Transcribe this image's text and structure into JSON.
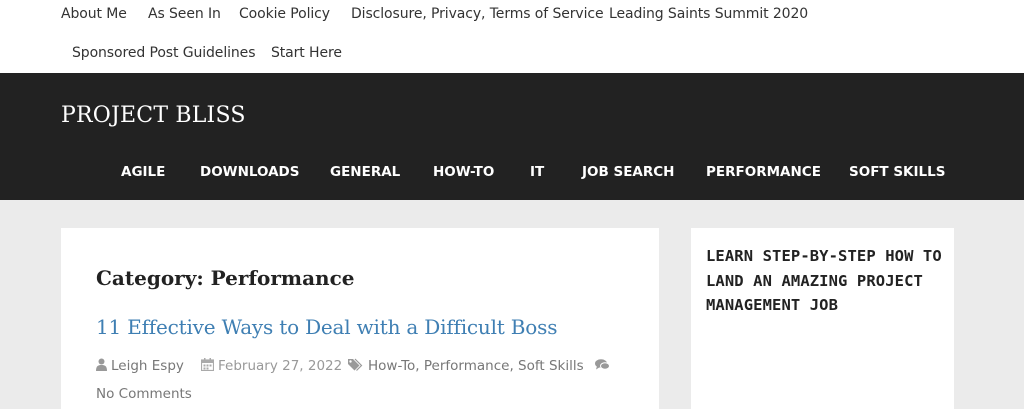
{
  "top_nav": {
    "items": [
      "About Me",
      "As Seen In",
      "Cookie Policy",
      "Disclosure, Privacy, Terms of Service",
      "Leading Saints Summit 2020",
      "Sponsored Post Guidelines",
      "Start Here"
    ]
  },
  "header": {
    "site_title": "PROJECT BLISS"
  },
  "main_nav": {
    "items": [
      "AGILE",
      "DOWNLOADS",
      "GENERAL",
      "HOW-TO",
      "IT",
      "JOB SEARCH",
      "PERFORMANCE",
      "SOFT SKILLS"
    ]
  },
  "archive": {
    "title": "Category: Performance"
  },
  "post": {
    "title": "11 Effective Ways to Deal with a Difficult Boss",
    "author": "Leigh Espy",
    "date": "February 27, 2022",
    "categories": [
      "How-To",
      "Performance",
      "Soft Skills"
    ],
    "comments": "No Comments"
  },
  "sidebar": {
    "widget_title": "LEARN STEP-BY-STEP HOW TO LAND AN AMAZING PROJECT MANAGEMENT JOB"
  },
  "colors": {
    "header_bg": "#222222",
    "page_bg": "#ebebeb",
    "link_blue": "#3f7fb3"
  },
  "icons": [
    "user-icon",
    "calendar-icon",
    "tags-icon",
    "comments-icon"
  ]
}
